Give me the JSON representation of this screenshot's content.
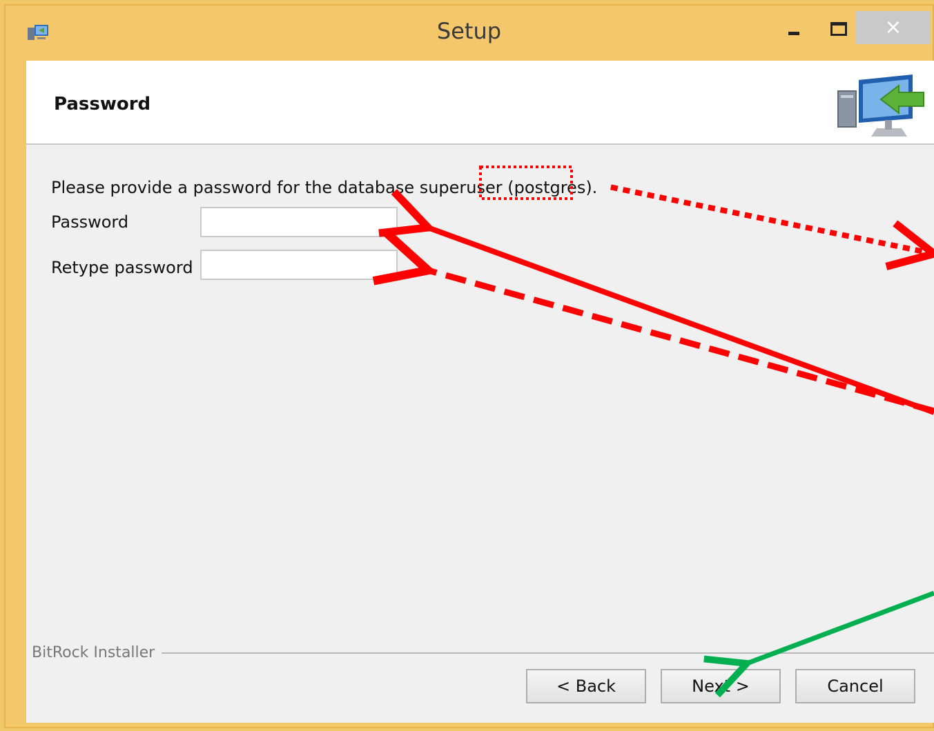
{
  "window": {
    "title": "Setup",
    "close_glyph": "×",
    "app_icon": "installer-icon"
  },
  "header": {
    "title": "Password",
    "icon": "computer-arrow-icon"
  },
  "form": {
    "prompt": "Please provide a password for the database superuser (postgres).",
    "password_label": "Password",
    "password_value": "",
    "retype_label": "Retype password",
    "retype_value": ""
  },
  "footer": {
    "brand": "BitRock Installer",
    "back_label": "< Back",
    "next_label": "Next >",
    "cancel_label": "Cancel"
  },
  "annotations": {
    "red": "#ff0000",
    "green": "#00b050"
  }
}
